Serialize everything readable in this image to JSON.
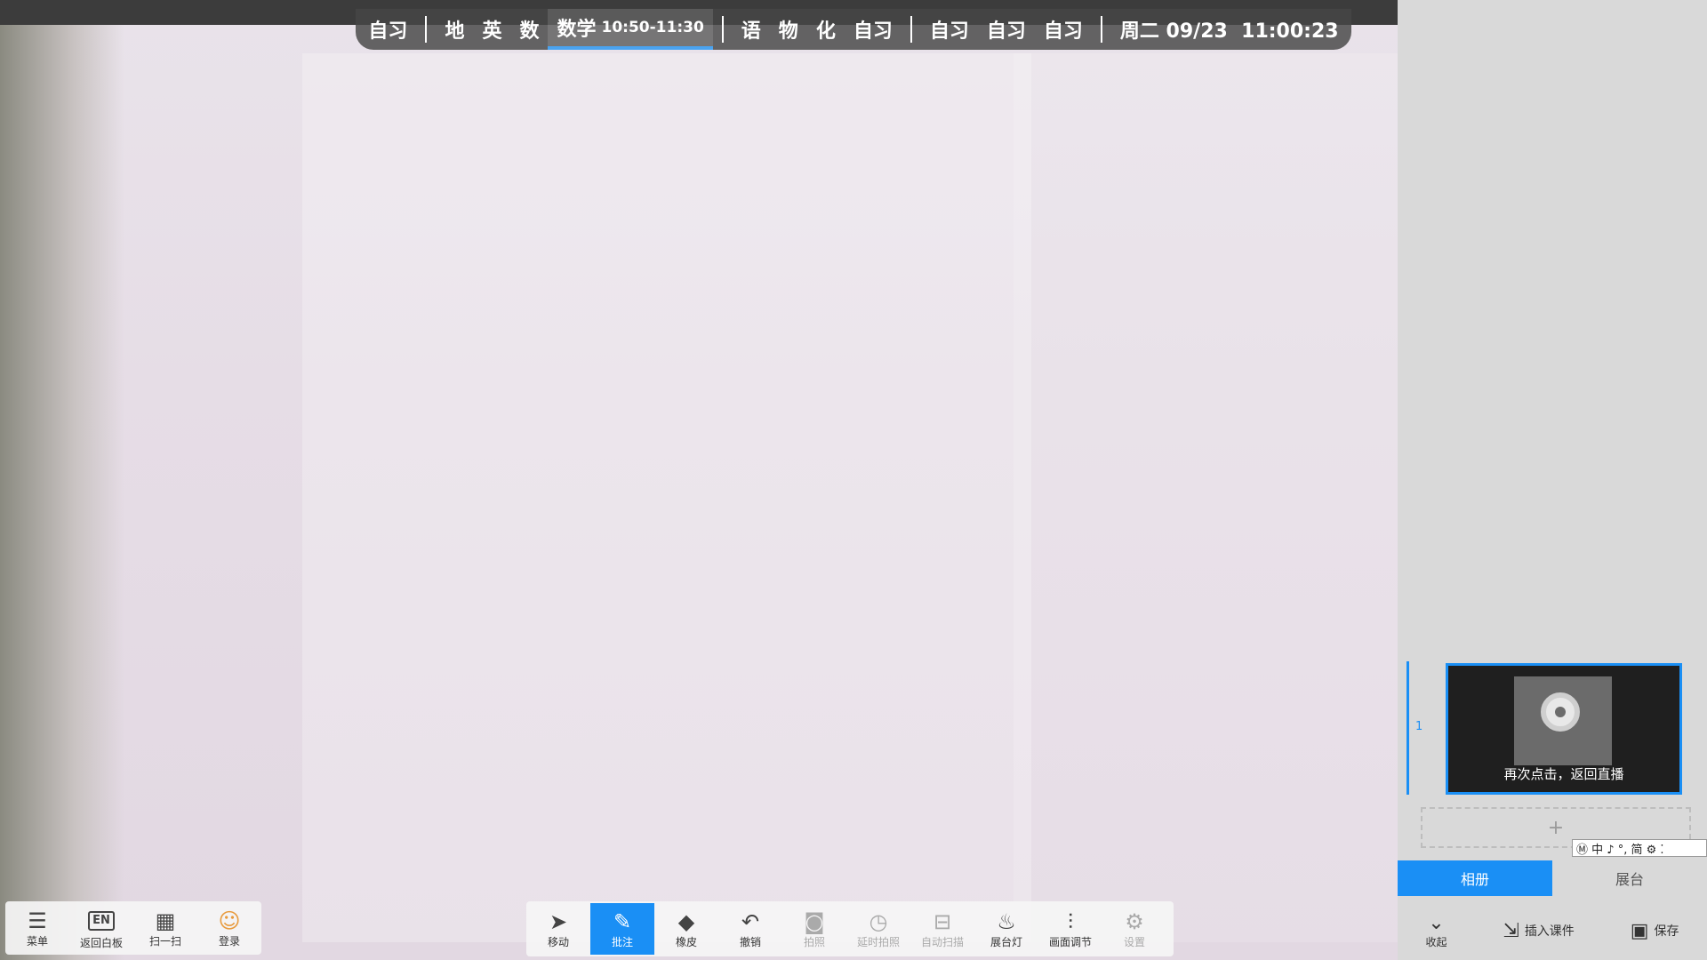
{
  "schedule": {
    "g1": [
      "自习"
    ],
    "g2_before": [
      "地",
      "英",
      "数"
    ],
    "current": {
      "label": "数学",
      "time": "10:50-11:30"
    },
    "g3": [
      "语",
      "物",
      "化",
      "自习"
    ],
    "g4": [
      "自习",
      "自习",
      "自习"
    ],
    "datetime": "周二 09/23  11:00:23"
  },
  "left_toolbar": {
    "menu": "菜单",
    "en_badge": "EN",
    "back_board": "返回白板",
    "scan": "扫一扫",
    "login": "登录"
  },
  "center_toolbar": {
    "move": "移动",
    "annotate": "批注",
    "eraser": "橡皮",
    "undo": "撤销",
    "photo": "拍照",
    "delay_photo": "延时拍照",
    "auto_scan": "自动扫描",
    "booth_light": "展台灯",
    "adjust": "画面调节",
    "settings": "设置"
  },
  "side_panel": {
    "thumb_index": "1",
    "thumb_caption": "再次点击，返回直播",
    "ime": "Ⓜ 中 ♪ °, 简 ⚙ ⁚",
    "tab_album": "相册",
    "tab_booth": "展台",
    "collapse": "收起",
    "insert": "插入课件",
    "save": "保存"
  },
  "colors": {
    "accent": "#1a8ff5"
  }
}
